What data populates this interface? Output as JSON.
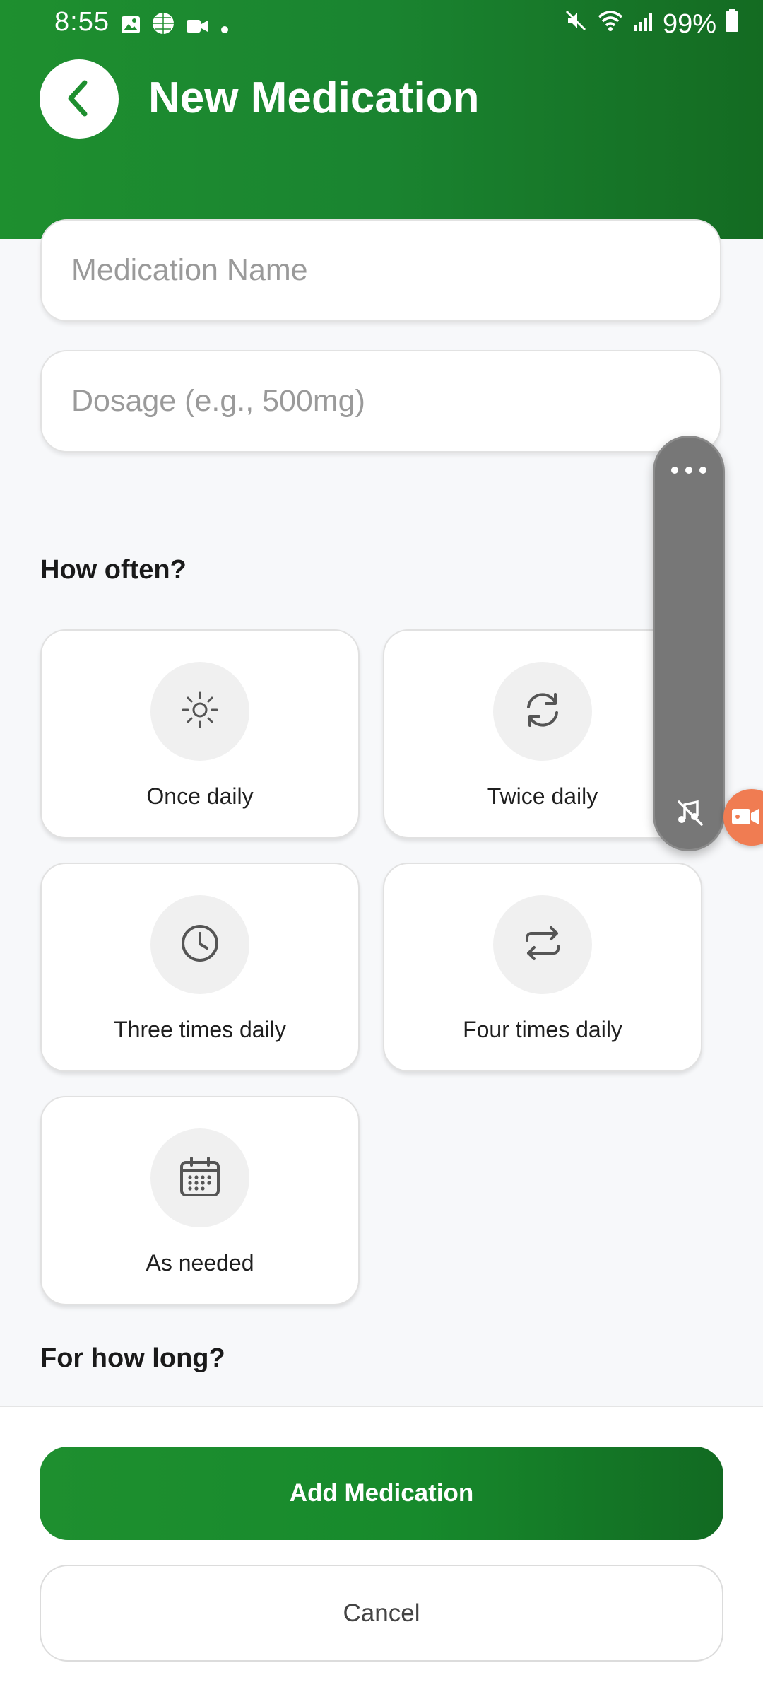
{
  "status_bar": {
    "time": "8:55",
    "battery": "99%"
  },
  "header": {
    "title": "New Medication",
    "back_icon": "chevron-left-icon",
    "color": "#1e8f2f"
  },
  "form": {
    "medication_name_placeholder": "Medication Name",
    "medication_name_value": "",
    "dosage_placeholder": "Dosage (e.g., 500mg)",
    "dosage_value": ""
  },
  "frequency": {
    "title": "How often?",
    "options": [
      {
        "label": "Once daily",
        "icon": "sun-icon"
      },
      {
        "label": "Twice daily",
        "icon": "refresh-icon"
      },
      {
        "label": "Three times daily",
        "icon": "clock-icon"
      },
      {
        "label": "Four times daily",
        "icon": "repeat-icon"
      },
      {
        "label": "As needed",
        "icon": "calendar-icon"
      }
    ]
  },
  "duration": {
    "title": "For how long?"
  },
  "actions": {
    "add_label": "Add Medication",
    "cancel_label": "Cancel"
  },
  "overlay": {
    "menu_icon": "more-dots-icon",
    "mute_icon": "mute-icon",
    "record_icon": "video-record-icon"
  },
  "colors": {
    "accent": "#1e8f2f",
    "accent_dark": "#126a22",
    "background": "#f7f8fa"
  }
}
